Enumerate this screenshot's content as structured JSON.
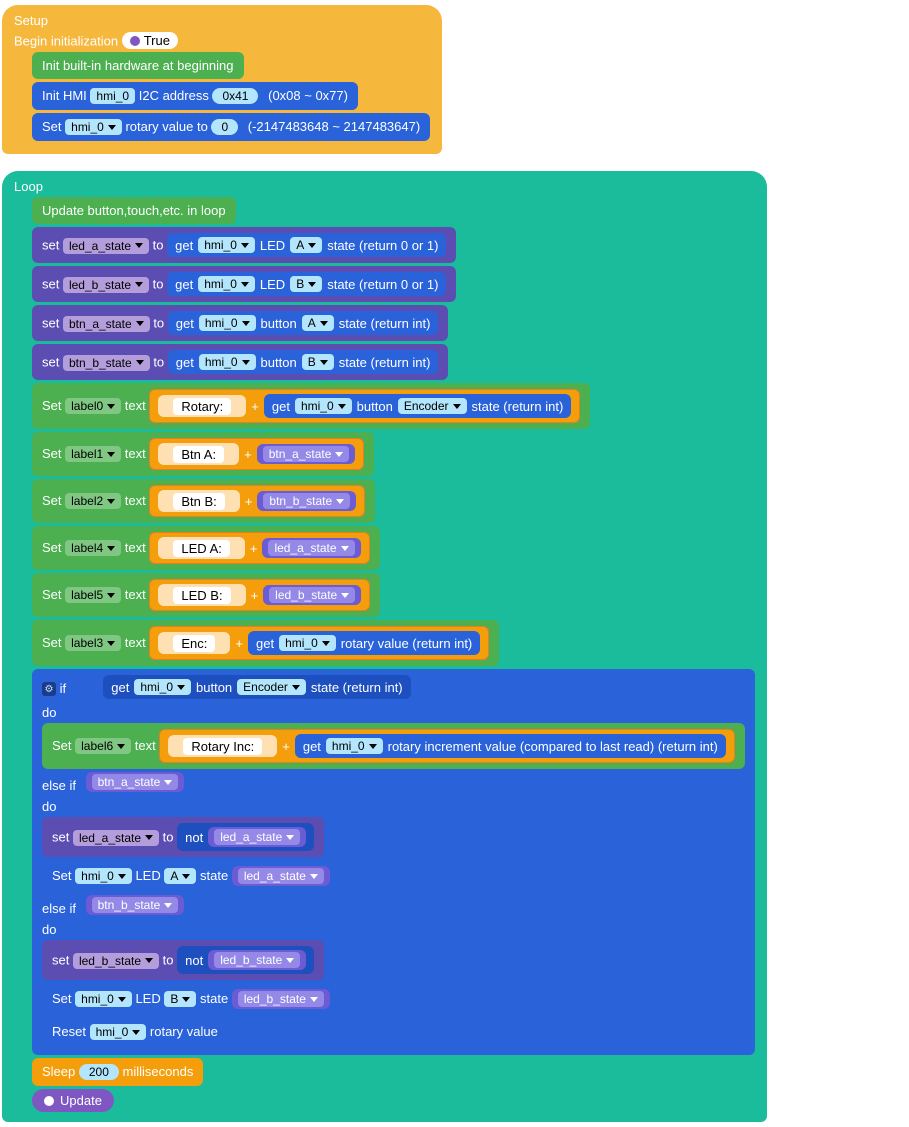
{
  "setup": {
    "title": "Setup",
    "begin": "Begin initialization",
    "true": "True",
    "initHw": "Init built-in hardware at beginning",
    "initHmiPre": "Init HMI",
    "hmi": "hmi_0",
    "i2cAddr": "I2C address",
    "addrVal": "0x41",
    "addrRange": "(0x08 ~ 0x77)",
    "setPre": "Set",
    "rotaryTo": "rotary value to",
    "rotaryVal": "0",
    "rotaryRange": "(-2147483648 ~ 2147483647)"
  },
  "loop": {
    "title": "Loop",
    "update": "Update button,touch,etc. in loop",
    "set": "set",
    "to": "to",
    "get": "get",
    "led": "LED",
    "button": "button",
    "stateRet01": "state (return 0 or 1)",
    "stateRetInt": "state (return int)",
    "ledAState": "led_a_state",
    "ledBState": "led_b_state",
    "btnAState": "btn_a_state",
    "btnBState": "btn_b_state",
    "A": "A",
    "B": "B",
    "encoder": "Encoder",
    "hmi": "hmi_0",
    "setCap": "Set",
    "text": "text",
    "label0": "label0",
    "label1": "label1",
    "label2": "label2",
    "label3": "label3",
    "label4": "label4",
    "label5": "label5",
    "label6": "label6",
    "strRotary": "Rotary:",
    "strBtnA": "Btn A:",
    "strBtnB": "Btn B:",
    "strLedA": "LED A:",
    "strLedB": "LED B:",
    "strEnc": "Enc:",
    "strRotaryInc": "Rotary Inc:",
    "plus": "+",
    "rotaryValueRet": "rotary value (return int)",
    "rotaryIncRet": "rotary increment value (compared to last read) (return int)",
    "if": "if",
    "do": "do",
    "elseif": "else if",
    "not": "not",
    "state": "state",
    "reset": "Reset",
    "rotaryValue": "rotary value",
    "sleep": "Sleep",
    "ms": "200",
    "msLabel": "milliseconds",
    "updateBtn": "Update"
  }
}
